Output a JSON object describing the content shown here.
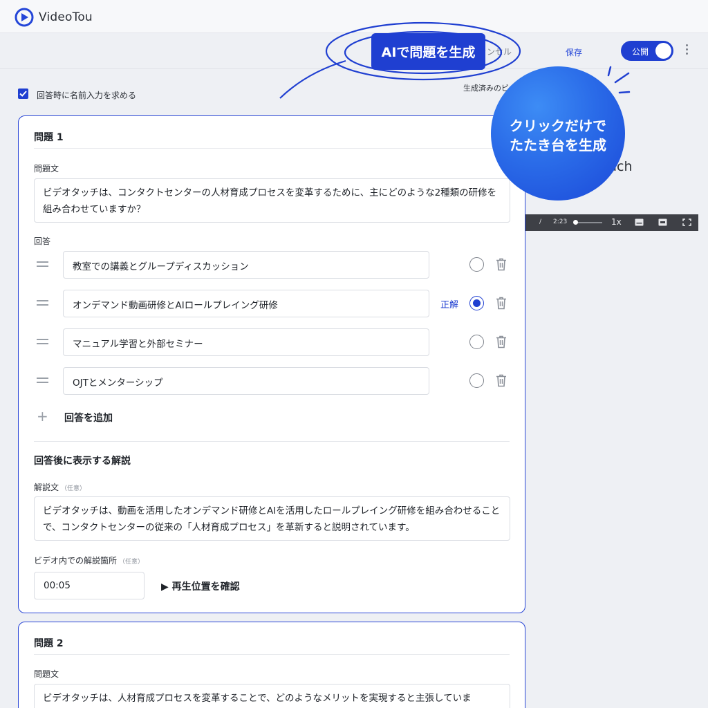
{
  "app": {
    "logo_text": "VideoTou"
  },
  "toolbar": {
    "ai_generate_label": "AIで問題を生成",
    "cancel_label": "ャンセル",
    "save_label": "保存",
    "publish_label": "公開"
  },
  "settings": {
    "require_name_label": "回答時に名前入力を求める",
    "generated_label": "生成済みのビ"
  },
  "promo": {
    "line1": "クリックだけで",
    "line2": "たたき台を生成"
  },
  "background_panel": {
    "title_fragment": "uch",
    "player": {
      "slash": "/",
      "duration": "2:23",
      "speed": "1x"
    }
  },
  "question1": {
    "title": "問題 1",
    "question_label": "問題文",
    "question_text": "ビデオタッチは、コンタクトセンターの人材育成プロセスを変革するために、主にどのような2種類の研修を組み合わせていますか？",
    "answers_label": "回答",
    "answers": [
      {
        "text": "教室での講義とグループディスカッション",
        "correct": false
      },
      {
        "text": "オンデマンド動画研修とAIロールプレイング研修",
        "correct": true
      },
      {
        "text": "マニュアル学習と外部セミナー",
        "correct": false
      },
      {
        "text": "OJTとメンターシップ",
        "correct": false
      }
    ],
    "correct_label": "正解",
    "add_answer_label": "回答を追加",
    "explanation_title": "回答後に表示する解説",
    "explanation_label": "解説文",
    "optional_tag": "（任意）",
    "explanation_text": "ビデオタッチは、動画を活用したオンデマンド研修とAIを活用したロールプレイング研修を組み合わせることで、コンタクトセンターの従来の「人材育成プロセス」を革新すると説明されています。",
    "video_position_label": "ビデオ内での解説箇所",
    "video_position_value": "00:05",
    "check_position_label": "▶ 再生位置を確認"
  },
  "question2": {
    "title": "問題 2",
    "question_label": "問題文",
    "question_text": "ビデオタッチは、人材育成プロセスを変革することで、どのようなメリットを実現すると主張していま"
  },
  "colors": {
    "accent": "#1f3fd1",
    "promo_gradient_end": "#1b48d8"
  }
}
